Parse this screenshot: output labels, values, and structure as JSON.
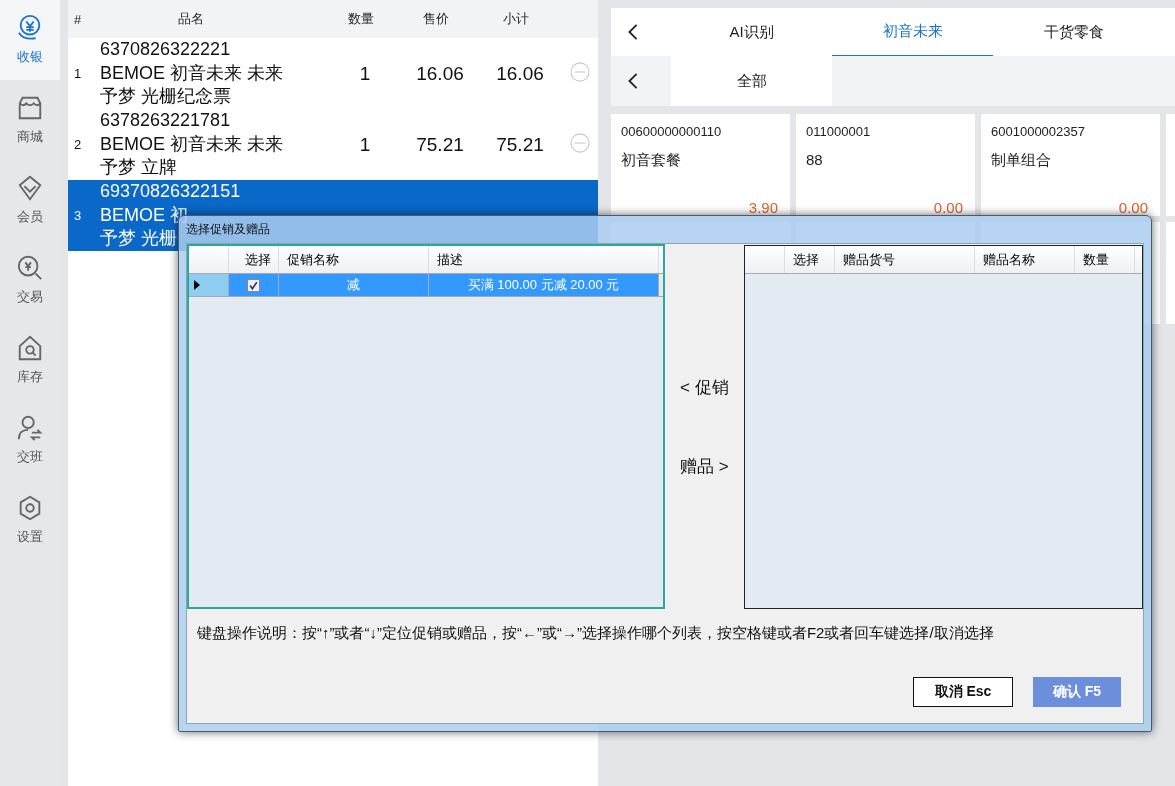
{
  "sidebar": {
    "items": [
      {
        "label": "收银",
        "kind": "cashier",
        "selected": true
      },
      {
        "label": "商城",
        "kind": "shop",
        "selected": false
      },
      {
        "label": "会员",
        "kind": "member",
        "selected": false
      },
      {
        "label": "交易",
        "kind": "trade",
        "selected": false
      },
      {
        "label": "库存",
        "kind": "stock",
        "selected": false
      },
      {
        "label": "交班",
        "kind": "shift",
        "selected": false
      },
      {
        "label": "设置",
        "kind": "settings",
        "selected": false
      }
    ]
  },
  "cart": {
    "columns": [
      "#",
      "品名",
      "数量",
      "售价",
      "小计"
    ],
    "rows": [
      {
        "index": "1",
        "lines": [
          "6370826322221",
          "BEMOE 初音未来 未来",
          "予梦 光栅纪念票"
        ],
        "qty": "1",
        "price": "16.06",
        "subtotal": "16.06",
        "selected": false
      },
      {
        "index": "2",
        "lines": [
          "6378263221781",
          "BEMOE 初音未来 未来",
          "予梦 立牌"
        ],
        "qty": "1",
        "price": "75.21",
        "subtotal": "75.21",
        "selected": false
      },
      {
        "index": "3",
        "lines": [
          "69370826322151",
          "BEMOE 初",
          "予梦 光栅"
        ],
        "selected": true
      }
    ]
  },
  "category_tabs": {
    "items": [
      {
        "label": "AI识别",
        "selected": false
      },
      {
        "label": "初音未来",
        "selected": true
      },
      {
        "label": "干货零食",
        "selected": false
      }
    ]
  },
  "sub_tabs": {
    "items": [
      {
        "label": "全部",
        "selected": true
      }
    ]
  },
  "products": [
    {
      "code": "00600000000110",
      "name": "初音套餐",
      "price": "3.90"
    },
    {
      "code": "011000001",
      "name": "88",
      "price": "0.00"
    },
    {
      "code": "6001000002357",
      "name": "制单组合",
      "price": "0.00"
    }
  ],
  "dialog": {
    "title": "选择促销及赠品",
    "promotions": {
      "columns": [
        "选择",
        "促销名称",
        "描述"
      ],
      "rows": [
        {
          "checked": true,
          "selected": true,
          "name": "减",
          "description": "买满 100.00 元减 20.00 元"
        }
      ]
    },
    "move_buttons": [
      "< 促销",
      "赠品 >"
    ],
    "gifts": {
      "columns": [
        "选择",
        "赠品货号",
        "赠品名称",
        "数量"
      ]
    },
    "instructions": "键盘操作说明：按“↑”或者“↓”定位促销或赠品，按“←”或“→”选择操作哪个列表，按空格键或者F2或者回车键选择/取消选择",
    "buttons": [
      {
        "label": "取消 Esc",
        "kind": "secondary"
      },
      {
        "label": "确认 F5",
        "kind": "primary"
      }
    ]
  }
}
